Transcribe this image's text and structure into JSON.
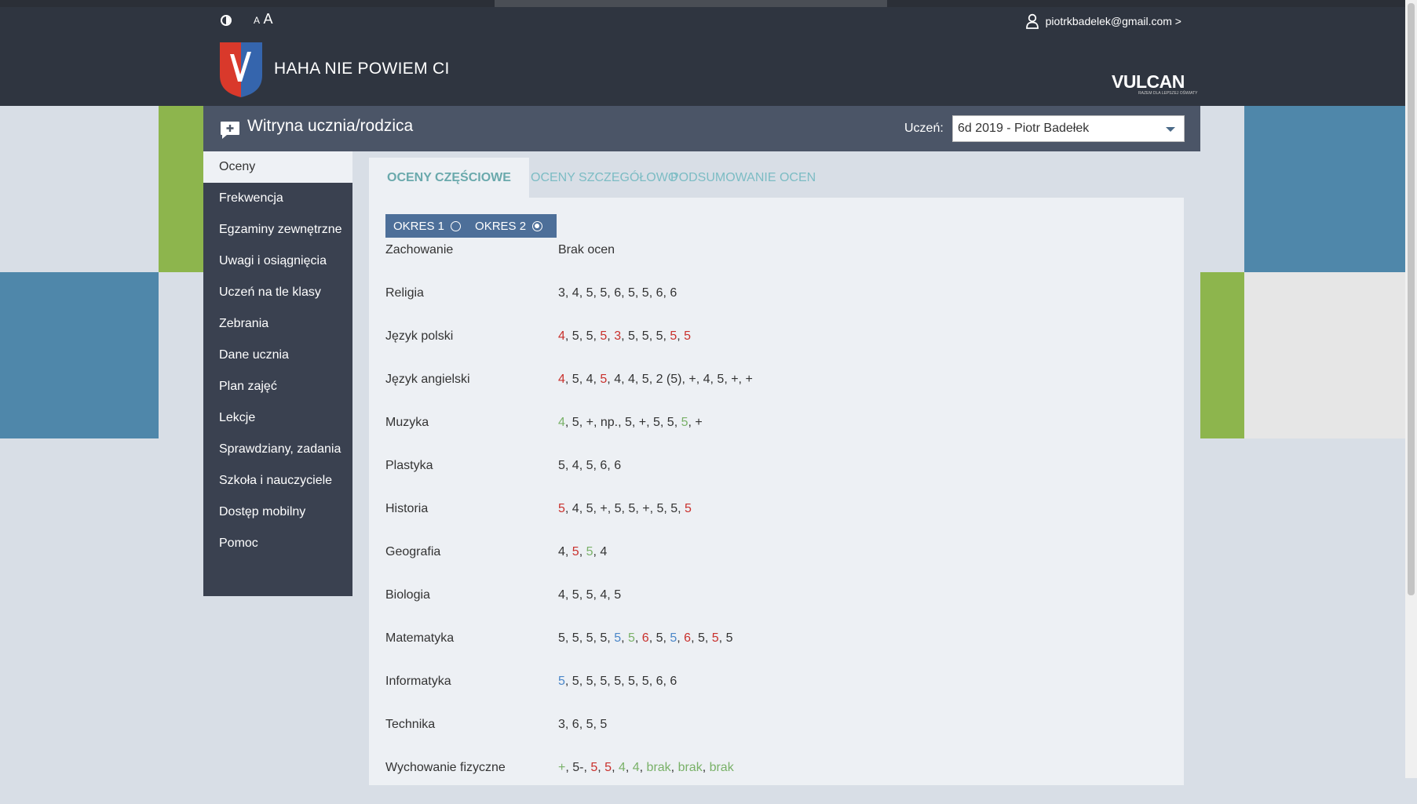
{
  "header": {
    "font_small": "A",
    "font_big": "A",
    "user_email": "piotrkbadelek@gmail.com >",
    "school_name": "HAHA NIE POWIEM CI",
    "vendor_logo": "VULCAN",
    "vendor_tagline": "RAZEM DLA LEPSZEJ OŚWIATY"
  },
  "titlebar": {
    "title": "Witryna ucznia/rodzica",
    "student_label": "Uczeń:",
    "student_value": "6d 2019 - Piotr Badełek"
  },
  "sidebar": {
    "items": [
      {
        "label": "Oceny",
        "active": true
      },
      {
        "label": "Frekwencja"
      },
      {
        "label": "Egzaminy zewnętrzne"
      },
      {
        "label": "Uwagi i osiągnięcia"
      },
      {
        "label": "Uczeń na tle klasy"
      },
      {
        "label": "Zebrania"
      },
      {
        "label": "Dane ucznia"
      },
      {
        "label": "Plan zajęć"
      },
      {
        "label": "Lekcje"
      },
      {
        "label": "Sprawdziany, zadania"
      },
      {
        "label": "Szkoła i nauczyciele"
      },
      {
        "label": "Dostęp mobilny"
      },
      {
        "label": "Pomoc"
      }
    ]
  },
  "tabs": [
    {
      "label": "OCENY CZĘŚCIOWE",
      "active": true
    },
    {
      "label": "OCENY SZCZEGÓŁOWO"
    },
    {
      "label": "PODSUMOWANIE OCEN"
    }
  ],
  "periods": [
    {
      "label": "OKRES 1",
      "selected": false
    },
    {
      "label": "OKRES 2",
      "selected": true
    }
  ],
  "colors": {
    "red": "#c9302c",
    "green": "#79b168",
    "blue": "#4a86c8",
    "header_bg": "#2f3540",
    "sidebar_bg": "#3a4150",
    "tab_text": "#7cbcc4"
  },
  "grades": [
    {
      "subject": "Zachowanie",
      "grades": [
        {
          "v": "Brak ocen"
        }
      ]
    },
    {
      "subject": "Religia",
      "grades": [
        {
          "v": "3"
        },
        {
          "v": "4"
        },
        {
          "v": "5"
        },
        {
          "v": "5"
        },
        {
          "v": "6"
        },
        {
          "v": "5"
        },
        {
          "v": "5"
        },
        {
          "v": "6"
        },
        {
          "v": "6"
        }
      ]
    },
    {
      "subject": "Język polski",
      "grades": [
        {
          "v": "4",
          "c": "r"
        },
        {
          "v": "5"
        },
        {
          "v": "5"
        },
        {
          "v": "5",
          "c": "r"
        },
        {
          "v": "3",
          "c": "r"
        },
        {
          "v": "5"
        },
        {
          "v": "5"
        },
        {
          "v": "5"
        },
        {
          "v": "5",
          "c": "r"
        },
        {
          "v": "5",
          "c": "r"
        }
      ]
    },
    {
      "subject": "Język angielski",
      "grades": [
        {
          "v": "4",
          "c": "r"
        },
        {
          "v": "5"
        },
        {
          "v": "4"
        },
        {
          "v": "5",
          "c": "r"
        },
        {
          "v": "4"
        },
        {
          "v": "4"
        },
        {
          "v": "5"
        },
        {
          "v": "2 (5)"
        },
        {
          "v": "+"
        },
        {
          "v": "4"
        },
        {
          "v": "5"
        },
        {
          "v": "+"
        },
        {
          "v": "+"
        }
      ]
    },
    {
      "subject": "Muzyka",
      "grades": [
        {
          "v": "4",
          "c": "g"
        },
        {
          "v": "5"
        },
        {
          "v": "+"
        },
        {
          "v": "np."
        },
        {
          "v": "5"
        },
        {
          "v": "+"
        },
        {
          "v": "5"
        },
        {
          "v": "5"
        },
        {
          "v": "5",
          "c": "g"
        },
        {
          "v": "+"
        }
      ]
    },
    {
      "subject": "Plastyka",
      "grades": [
        {
          "v": "5"
        },
        {
          "v": "4"
        },
        {
          "v": "5"
        },
        {
          "v": "6"
        },
        {
          "v": "6"
        }
      ]
    },
    {
      "subject": "Historia",
      "grades": [
        {
          "v": "5",
          "c": "r"
        },
        {
          "v": "4"
        },
        {
          "v": "5"
        },
        {
          "v": "+"
        },
        {
          "v": "5"
        },
        {
          "v": "5"
        },
        {
          "v": "+"
        },
        {
          "v": "5"
        },
        {
          "v": "5"
        },
        {
          "v": "5",
          "c": "r"
        }
      ]
    },
    {
      "subject": "Geografia",
      "grades": [
        {
          "v": "4"
        },
        {
          "v": "5",
          "c": "r"
        },
        {
          "v": "5",
          "c": "g"
        },
        {
          "v": "4"
        }
      ]
    },
    {
      "subject": "Biologia",
      "grades": [
        {
          "v": "4"
        },
        {
          "v": "5"
        },
        {
          "v": "5"
        },
        {
          "v": "4"
        },
        {
          "v": "5"
        }
      ]
    },
    {
      "subject": "Matematyka",
      "grades": [
        {
          "v": "5"
        },
        {
          "v": "5"
        },
        {
          "v": "5"
        },
        {
          "v": "5"
        },
        {
          "v": "5",
          "c": "b"
        },
        {
          "v": "5",
          "c": "g"
        },
        {
          "v": "6",
          "c": "r"
        },
        {
          "v": "5"
        },
        {
          "v": "5",
          "c": "b"
        },
        {
          "v": "6",
          "c": "r"
        },
        {
          "v": "5"
        },
        {
          "v": "5",
          "c": "r"
        },
        {
          "v": "5"
        }
      ]
    },
    {
      "subject": "Informatyka",
      "grades": [
        {
          "v": "5",
          "c": "b"
        },
        {
          "v": "5"
        },
        {
          "v": "5"
        },
        {
          "v": "5"
        },
        {
          "v": "5"
        },
        {
          "v": "5"
        },
        {
          "v": "5"
        },
        {
          "v": "6"
        },
        {
          "v": "6"
        }
      ]
    },
    {
      "subject": "Technika",
      "grades": [
        {
          "v": "3"
        },
        {
          "v": "6"
        },
        {
          "v": "5"
        },
        {
          "v": "5"
        }
      ]
    },
    {
      "subject": "Wychowanie fizyczne",
      "grades": [
        {
          "v": "+",
          "c": "g"
        },
        {
          "v": "5-"
        },
        {
          "v": "5",
          "c": "r"
        },
        {
          "v": "5",
          "c": "r"
        },
        {
          "v": "4",
          "c": "g"
        },
        {
          "v": "4",
          "c": "g"
        },
        {
          "v": "brak",
          "c": "g"
        },
        {
          "v": "brak",
          "c": "g"
        },
        {
          "v": "brak",
          "c": "g"
        }
      ]
    }
  ]
}
